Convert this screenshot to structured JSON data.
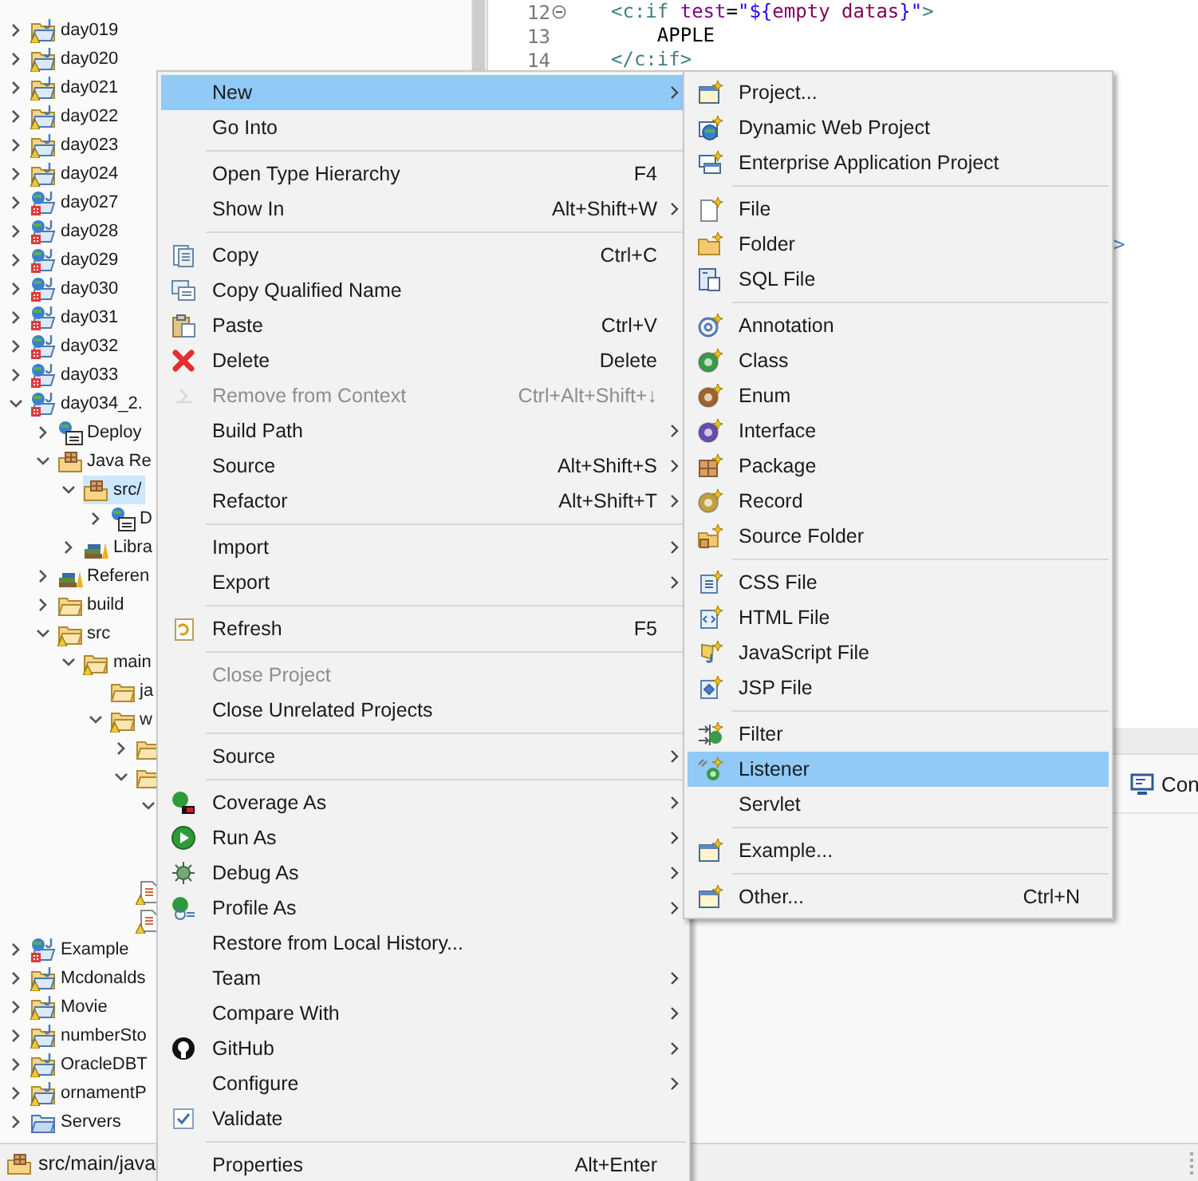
{
  "tree": {
    "items": [
      {
        "label": "day019",
        "kind": "project-warning",
        "expanded": false,
        "selected": false
      },
      {
        "label": "day020",
        "kind": "project-warning",
        "expanded": false,
        "selected": false
      },
      {
        "label": "day021",
        "kind": "project-warning",
        "expanded": false,
        "selected": false
      },
      {
        "label": "day022",
        "kind": "project-warning",
        "expanded": false,
        "selected": false
      },
      {
        "label": "day023",
        "kind": "project-warning",
        "expanded": false,
        "selected": false
      },
      {
        "label": "day024",
        "kind": "project-warning",
        "expanded": false,
        "selected": false
      },
      {
        "label": "day027",
        "kind": "web-project-error",
        "expanded": false,
        "selected": false
      },
      {
        "label": "day028",
        "kind": "web-project-error",
        "expanded": false,
        "selected": false
      },
      {
        "label": "day029",
        "kind": "web-project-error",
        "expanded": false,
        "selected": false
      },
      {
        "label": "day030",
        "kind": "web-project-error",
        "expanded": false,
        "selected": false
      },
      {
        "label": "day031",
        "kind": "web-project-error",
        "expanded": false,
        "selected": false
      },
      {
        "label": "day032",
        "kind": "web-project-error",
        "expanded": false,
        "selected": false
      },
      {
        "label": "day033",
        "kind": "web-project-error",
        "expanded": false,
        "selected": false
      },
      {
        "label": "day034_2.",
        "kind": "web-project-error",
        "expanded": true,
        "selected": false,
        "children": [
          {
            "label": "Deploy",
            "kind": "deployment",
            "expanded": false,
            "selected": false
          },
          {
            "label": "Java Re",
            "kind": "java-resources",
            "expanded": true,
            "selected": false,
            "children": [
              {
                "label": "src/",
                "kind": "package-root",
                "expanded": true,
                "selected": true,
                "children": [
                  {
                    "label": "D",
                    "kind": "deployment",
                    "expanded": false,
                    "selected": false
                  }
                ]
              },
              {
                "label": "Libra",
                "kind": "library",
                "expanded": false,
                "selected": false
              }
            ]
          },
          {
            "label": "Referen",
            "kind": "library",
            "expanded": false,
            "selected": false
          },
          {
            "label": "build",
            "kind": "folder",
            "expanded": false,
            "selected": false
          },
          {
            "label": "src",
            "kind": "folder-warning",
            "expanded": true,
            "selected": false,
            "children": [
              {
                "label": "main",
                "kind": "folder-warning",
                "expanded": true,
                "selected": false,
                "children": [
                  {
                    "label": "ja",
                    "kind": "folder",
                    "selected": false
                  },
                  {
                    "label": "w",
                    "kind": "folder-warning",
                    "expanded": true,
                    "selected": false,
                    "children": [
                      {
                        "kind": "folder",
                        "expanded": false,
                        "selected": false
                      },
                      {
                        "kind": "folder",
                        "expanded": true,
                        "selected": false,
                        "children": [
                          {
                            "expanded": true
                          }
                        ]
                      },
                      {
                        "kind": "file-warning",
                        "selected": false
                      },
                      {
                        "kind": "file-warning",
                        "selected": false
                      }
                    ]
                  }
                ]
              }
            ]
          }
        ]
      },
      {
        "label": "Example",
        "kind": "web-project-error",
        "expanded": false,
        "selected": false
      },
      {
        "label": "Mcdonalds",
        "kind": "project-warning",
        "expanded": false,
        "selected": false
      },
      {
        "label": "Movie",
        "kind": "project-warning",
        "expanded": false,
        "selected": false
      },
      {
        "label": "numberSto",
        "kind": "project-warning",
        "expanded": false,
        "selected": false
      },
      {
        "label": "OracleDBT",
        "kind": "project-warning",
        "expanded": false,
        "selected": false
      },
      {
        "label": "ornamentP",
        "kind": "project-warning",
        "expanded": false,
        "selected": false
      },
      {
        "label": "Servers",
        "kind": "plain-project",
        "expanded": false,
        "selected": false
      }
    ]
  },
  "editor": {
    "lines": [
      {
        "number": "12",
        "fold_marker": true,
        "tokens": [
          {
            "kind": "tag",
            "text": "<c:if"
          },
          {
            "kind": "attr",
            "text": " test"
          },
          {
            "kind": "plain",
            "text": "="
          },
          {
            "kind": "string",
            "text": "\"${"
          },
          {
            "kind": "el",
            "text": "empty datas"
          },
          {
            "kind": "string",
            "text": "}\""
          },
          {
            "kind": "tag",
            "text": ">"
          }
        ]
      },
      {
        "number": "13",
        "fold_marker": false,
        "tokens": [
          {
            "kind": "plain",
            "text": "    APPLE"
          }
        ]
      },
      {
        "number": "14",
        "fold_marker": false,
        "tokens": [
          {
            "kind": "tag",
            "text": "</c:if>"
          }
        ]
      }
    ],
    "fragment": ">"
  },
  "context_menu": {
    "entries": [
      {
        "kind": "item",
        "label": "New",
        "submenu": true,
        "selected": true,
        "disabled": false
      },
      {
        "kind": "item",
        "label": "Go Into",
        "submenu": false,
        "selected": false,
        "disabled": false
      },
      {
        "kind": "separator"
      },
      {
        "kind": "item",
        "label": "Open Type Hierarchy",
        "shortcut": "F4",
        "submenu": false,
        "selected": false,
        "disabled": false
      },
      {
        "kind": "item",
        "label": "Show In",
        "shortcut": "Alt+Shift+W",
        "submenu": true,
        "selected": false,
        "disabled": false
      },
      {
        "kind": "separator"
      },
      {
        "kind": "item",
        "label": "Copy",
        "shortcut": "Ctrl+C",
        "submenu": false,
        "selected": false,
        "disabled": false
      },
      {
        "kind": "item",
        "label": "Copy Qualified Name",
        "submenu": false,
        "selected": false,
        "disabled": false
      },
      {
        "kind": "item",
        "label": "Paste",
        "shortcut": "Ctrl+V",
        "submenu": false,
        "selected": false,
        "disabled": false
      },
      {
        "kind": "item",
        "label": "Delete",
        "shortcut": "Delete",
        "submenu": false,
        "selected": false,
        "disabled": false
      },
      {
        "kind": "item",
        "label": "Remove from Context",
        "shortcut": "Ctrl+Alt+Shift+↓",
        "submenu": false,
        "selected": false,
        "disabled": true
      },
      {
        "kind": "item",
        "label": "Build Path",
        "submenu": true,
        "selected": false,
        "disabled": false
      },
      {
        "kind": "item",
        "label": "Source",
        "shortcut": "Alt+Shift+S",
        "submenu": true,
        "selected": false,
        "disabled": false
      },
      {
        "kind": "item",
        "label": "Refactor",
        "shortcut": "Alt+Shift+T",
        "submenu": true,
        "selected": false,
        "disabled": false
      },
      {
        "kind": "separator"
      },
      {
        "kind": "item",
        "label": "Import",
        "submenu": true,
        "selected": false,
        "disabled": false
      },
      {
        "kind": "item",
        "label": "Export",
        "submenu": true,
        "selected": false,
        "disabled": false
      },
      {
        "kind": "separator"
      },
      {
        "kind": "item",
        "label": "Refresh",
        "shortcut": "F5",
        "submenu": false,
        "selected": false,
        "disabled": false
      },
      {
        "kind": "separator"
      },
      {
        "kind": "item",
        "label": "Close Project",
        "submenu": false,
        "selected": false,
        "disabled": true
      },
      {
        "kind": "item",
        "label": "Close Unrelated Projects",
        "submenu": false,
        "selected": false,
        "disabled": false
      },
      {
        "kind": "separator"
      },
      {
        "kind": "item",
        "label": "Source",
        "submenu": true,
        "selected": false,
        "disabled": false
      },
      {
        "kind": "separator"
      },
      {
        "kind": "item",
        "label": "Coverage As",
        "submenu": true,
        "selected": false,
        "disabled": false
      },
      {
        "kind": "item",
        "label": "Run As",
        "submenu": true,
        "selected": false,
        "disabled": false
      },
      {
        "kind": "item",
        "label": "Debug As",
        "submenu": true,
        "selected": false,
        "disabled": false
      },
      {
        "kind": "item",
        "label": "Profile As",
        "submenu": true,
        "selected": false,
        "disabled": false
      },
      {
        "kind": "item",
        "label": "Restore from Local History...",
        "submenu": false,
        "selected": false,
        "disabled": false
      },
      {
        "kind": "item",
        "label": "Team",
        "submenu": true,
        "selected": false,
        "disabled": false
      },
      {
        "kind": "item",
        "label": "Compare With",
        "submenu": true,
        "selected": false,
        "disabled": false
      },
      {
        "kind": "item",
        "label": "GitHub",
        "submenu": true,
        "selected": false,
        "disabled": false
      },
      {
        "kind": "item",
        "label": "Configure",
        "submenu": true,
        "selected": false,
        "disabled": false
      },
      {
        "kind": "item",
        "label": "Validate",
        "submenu": false,
        "selected": false,
        "disabled": false
      },
      {
        "kind": "separator"
      },
      {
        "kind": "item",
        "label": "Properties",
        "shortcut": "Alt+Enter",
        "submenu": false,
        "selected": false,
        "disabled": false
      }
    ]
  },
  "new_submenu": {
    "entries": [
      {
        "kind": "item",
        "label": "Project...",
        "selected": false
      },
      {
        "kind": "item",
        "label": "Dynamic Web Project",
        "selected": false
      },
      {
        "kind": "item",
        "label": "Enterprise Application Project",
        "selected": false
      },
      {
        "kind": "separator"
      },
      {
        "kind": "item",
        "label": "File",
        "selected": false
      },
      {
        "kind": "item",
        "label": "Folder",
        "selected": false
      },
      {
        "kind": "item",
        "label": "SQL File",
        "selected": false
      },
      {
        "kind": "separator"
      },
      {
        "kind": "item",
        "label": "Annotation",
        "selected": false
      },
      {
        "kind": "item",
        "label": "Class",
        "selected": false
      },
      {
        "kind": "item",
        "label": "Enum",
        "selected": false
      },
      {
        "kind": "item",
        "label": "Interface",
        "selected": false
      },
      {
        "kind": "item",
        "label": "Package",
        "selected": false
      },
      {
        "kind": "item",
        "label": "Record",
        "selected": false
      },
      {
        "kind": "item",
        "label": "Source Folder",
        "selected": false
      },
      {
        "kind": "separator"
      },
      {
        "kind": "item",
        "label": "CSS File",
        "selected": false
      },
      {
        "kind": "item",
        "label": "HTML File",
        "selected": false
      },
      {
        "kind": "item",
        "label": "JavaScript File",
        "selected": false
      },
      {
        "kind": "item",
        "label": "JSP File",
        "selected": false
      },
      {
        "kind": "separator"
      },
      {
        "kind": "item",
        "label": "Filter",
        "selected": false
      },
      {
        "kind": "item",
        "label": "Listener",
        "selected": true
      },
      {
        "kind": "item",
        "label": "Servlet",
        "selected": false
      },
      {
        "kind": "separator"
      },
      {
        "kind": "item",
        "label": "Example...",
        "selected": false
      },
      {
        "kind": "separator"
      },
      {
        "kind": "item",
        "label": "Other...",
        "shortcut": "Ctrl+N",
        "selected": false
      }
    ]
  },
  "bottom_panel": {
    "tabs": [
      {
        "label": "Con"
      }
    ]
  },
  "status_bar": {
    "text": "src/main/java"
  }
}
